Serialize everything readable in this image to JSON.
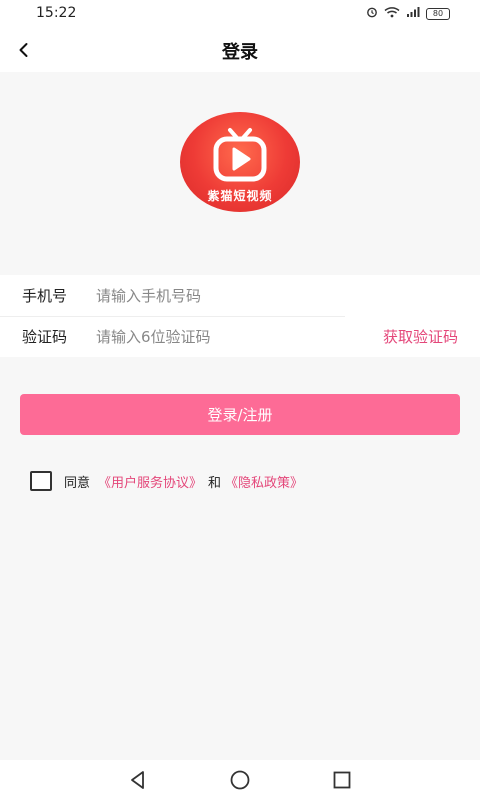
{
  "status_bar": {
    "time": "15:22",
    "icons": [
      "alarm-icon",
      "wifi-icon",
      "signal-icon"
    ],
    "battery": "80"
  },
  "nav": {
    "title": "登录",
    "back_icon": "chevron-left-icon"
  },
  "logo": {
    "text": "紫猫短视频"
  },
  "form": {
    "phone_label": "手机号",
    "phone_placeholder": "请输入手机号码",
    "phone_value": "",
    "code_label": "验证码",
    "code_placeholder": "请输入6位验证码",
    "code_value": "",
    "get_code_label": "获取验证码"
  },
  "login_button": "登录/注册",
  "agreement": {
    "checked": false,
    "prefix": "同意",
    "terms": "《用户服务协议》",
    "and": "和",
    "privacy": "《隐私政策》"
  },
  "colors": {
    "accent": "#fd6b96",
    "link": "#e4477a",
    "logo_red": "#ee3b36",
    "background": "#f7f7f7"
  }
}
